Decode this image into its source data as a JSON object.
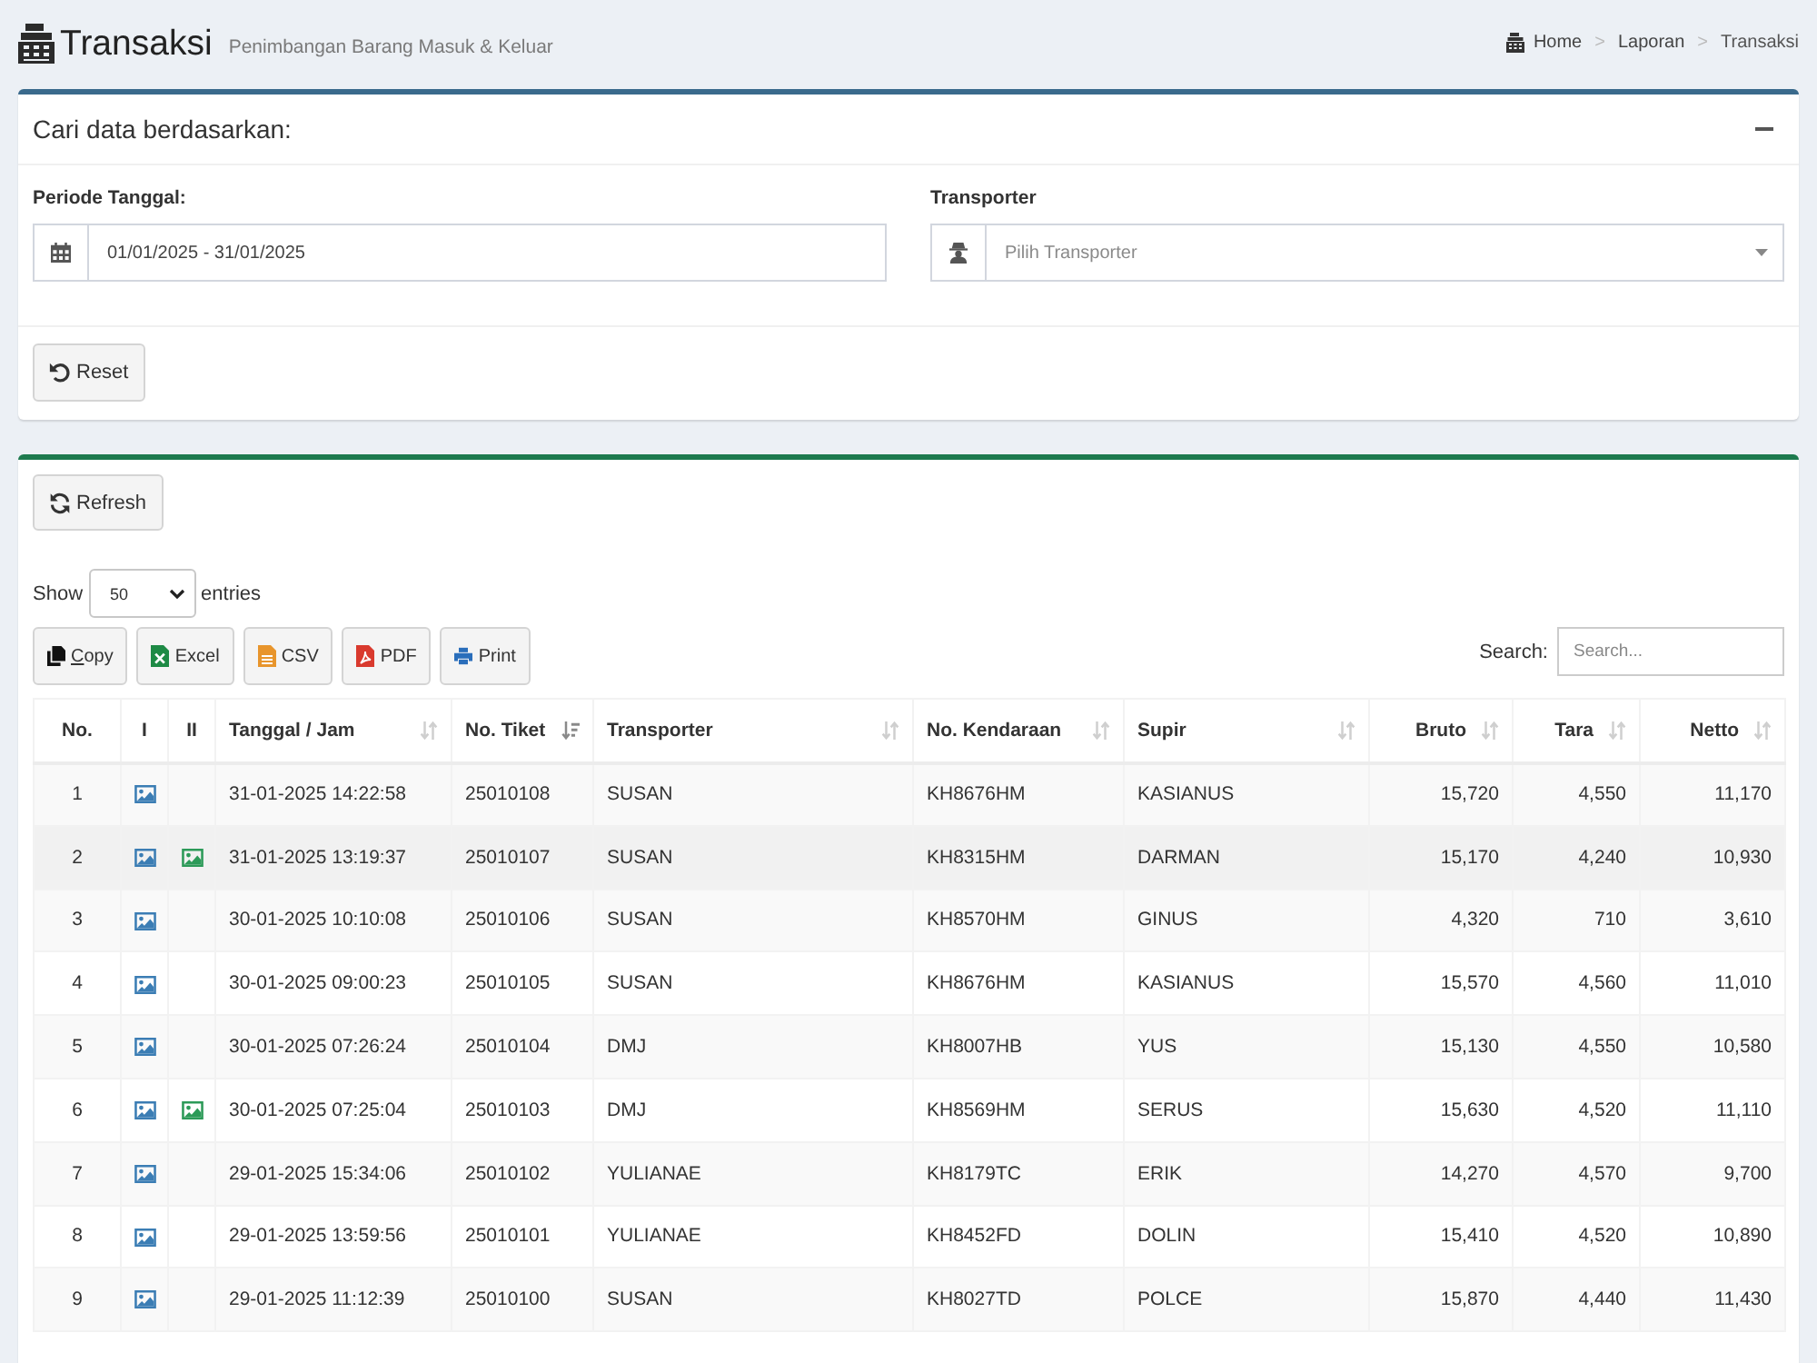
{
  "header": {
    "title": "Transaksi",
    "subtitle": "Penimbangan Barang Masuk & Keluar",
    "breadcrumb": [
      {
        "label": "Home"
      },
      {
        "separator": ">",
        "label": "Laporan"
      },
      {
        "separator": ">",
        "label": "Transaksi"
      }
    ]
  },
  "filter": {
    "title": "Cari data berdasarkan:",
    "fields": [
      {
        "kind": "date",
        "label": "Periode Tanggal:",
        "value": "01/01/2025 - 31/01/2025"
      },
      {
        "kind": "select",
        "label": "Transporter",
        "placeholder": "Pilih Transporter"
      }
    ],
    "reset_button": "Reset"
  },
  "results": {
    "refresh_button": "Refresh",
    "length": {
      "prefix": "Show",
      "value": "50",
      "suffix": "entries"
    },
    "export_buttons": [
      {
        "kind": "copy",
        "label": "Copy",
        "underline_first": true
      },
      {
        "kind": "excel",
        "label": "Excel",
        "underline_first": false
      },
      {
        "kind": "csv",
        "label": "CSV",
        "underline_first": false
      },
      {
        "kind": "pdf",
        "label": "PDF",
        "underline_first": false
      },
      {
        "kind": "print",
        "label": "Print",
        "underline_first": false
      }
    ],
    "search": {
      "label": "Search:",
      "placeholder": "Search..."
    }
  },
  "table": {
    "columns": [
      {
        "label": "No.",
        "kind": "index",
        "sortable": false,
        "sorted": false
      },
      {
        "label": "I",
        "kind": "image",
        "sortable": false,
        "sorted": false,
        "color": "#3b7db4"
      },
      {
        "label": "II",
        "kind": "image",
        "sortable": false,
        "sorted": false,
        "color": "#2c9a58"
      },
      {
        "label": "Tanggal / Jam",
        "kind": "text",
        "sortable": true,
        "sorted": false
      },
      {
        "label": "No. Tiket",
        "kind": "text",
        "sortable": true,
        "sorted": true
      },
      {
        "label": "Transporter",
        "kind": "text",
        "sortable": true,
        "sorted": false
      },
      {
        "label": "No. Kendaraan",
        "kind": "text",
        "sortable": true,
        "sorted": false
      },
      {
        "label": "Supir",
        "kind": "text",
        "sortable": true,
        "sorted": false
      },
      {
        "label": "Bruto",
        "kind": "number",
        "sortable": true,
        "sorted": false
      },
      {
        "label": "Tara",
        "kind": "number",
        "sortable": true,
        "sorted": false
      },
      {
        "label": "Netto",
        "kind": "number",
        "sortable": true,
        "sorted": false
      }
    ],
    "rows": [
      {
        "highlighted": false,
        "cells": [
          "1",
          {
            "photo": true
          },
          {
            "photo": false
          },
          "31-01-2025 14:22:58",
          "25010108",
          "SUSAN",
          "KH8676HM",
          "KASIANUS",
          "15,720",
          "4,550",
          "11,170"
        ]
      },
      {
        "highlighted": true,
        "cells": [
          "2",
          {
            "photo": true
          },
          {
            "photo": true
          },
          "31-01-2025 13:19:37",
          "25010107",
          "SUSAN",
          "KH8315HM",
          "DARMAN",
          "15,170",
          "4,240",
          "10,930"
        ]
      },
      {
        "highlighted": false,
        "cells": [
          "3",
          {
            "photo": true
          },
          {
            "photo": false
          },
          "30-01-2025 10:10:08",
          "25010106",
          "SUSAN",
          "KH8570HM",
          "GINUS",
          "4,320",
          "710",
          "3,610"
        ]
      },
      {
        "highlighted": false,
        "cells": [
          "4",
          {
            "photo": true
          },
          {
            "photo": false
          },
          "30-01-2025 09:00:23",
          "25010105",
          "SUSAN",
          "KH8676HM",
          "KASIANUS",
          "15,570",
          "4,560",
          "11,010"
        ]
      },
      {
        "highlighted": false,
        "cells": [
          "5",
          {
            "photo": true
          },
          {
            "photo": false
          },
          "30-01-2025 07:26:24",
          "25010104",
          "DMJ",
          "KH8007HB",
          "YUS",
          "15,130",
          "4,550",
          "10,580"
        ]
      },
      {
        "highlighted": false,
        "cells": [
          "6",
          {
            "photo": true
          },
          {
            "photo": true
          },
          "30-01-2025 07:25:04",
          "25010103",
          "DMJ",
          "KH8569HM",
          "SERUS",
          "15,630",
          "4,520",
          "11,110"
        ]
      },
      {
        "highlighted": false,
        "cells": [
          "7",
          {
            "photo": true
          },
          {
            "photo": false
          },
          "29-01-2025 15:34:06",
          "25010102",
          "YULIANAE",
          "KH8179TC",
          "ERIK",
          "14,270",
          "4,570",
          "9,700"
        ]
      },
      {
        "highlighted": false,
        "cells": [
          "8",
          {
            "photo": true
          },
          {
            "photo": false
          },
          "29-01-2025 13:59:56",
          "25010101",
          "YULIANAE",
          "KH8452FD",
          "DOLIN",
          "15,410",
          "4,520",
          "10,890"
        ]
      },
      {
        "highlighted": false,
        "cells": [
          "9",
          {
            "photo": true
          },
          {
            "photo": false
          },
          "29-01-2025 11:12:39",
          "25010100",
          "SUSAN",
          "KH8027TD",
          "POLCE",
          "15,870",
          "4,440",
          "11,430"
        ]
      }
    ]
  }
}
